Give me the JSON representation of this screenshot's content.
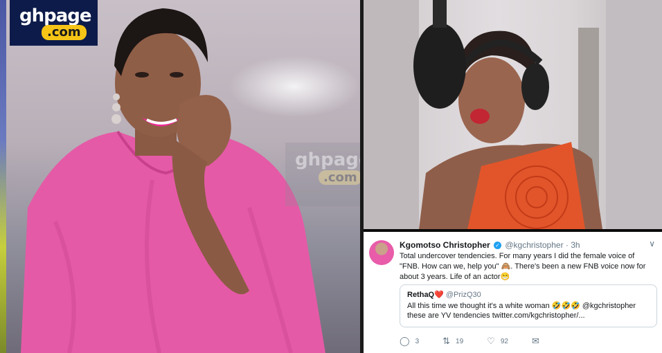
{
  "logo": {
    "gh": "ghpage",
    "com": ".com"
  },
  "watermark": {
    "gh": "ghpage",
    "com": ".com"
  },
  "tweet": {
    "author_name": "Kgomotso Christopher",
    "author_handle": "@kgchristopher",
    "time": "· 3h",
    "caret": "∨",
    "text": "Total undercover tendencies. For many years I did the female voice of \"FNB. How can we, help you\" 🙈. There's been a new FNB voice now for about 3 years. Life of an actor😁",
    "quote": {
      "name": "RethaQ",
      "heart": "❤️",
      "handle": "@PrizQ30",
      "text": "All this time we thought it's a white woman 🤣🤣🤣 @kgchristopher these are YV tendencies twitter.com/kgchristopher/..."
    },
    "actions": {
      "reply_count": "3",
      "retweet_count": "19",
      "like_count": "92"
    }
  },
  "colors": {
    "brand_navy": "#0d1b4a",
    "brand_yellow": "#f5c416",
    "twitter_blue": "#1da1f2",
    "pink_dress": "#e55aa6"
  }
}
